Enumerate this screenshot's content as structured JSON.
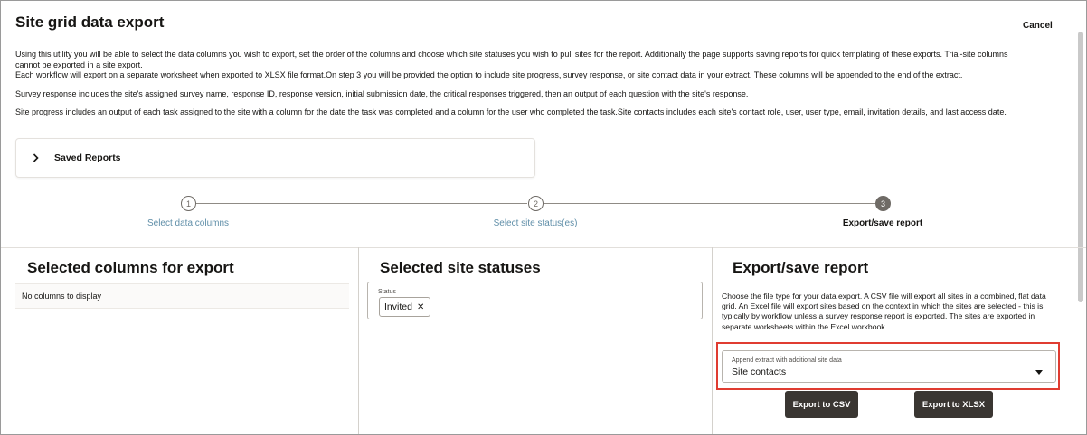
{
  "header": {
    "title": "Site grid data export",
    "cancel_label": "Cancel"
  },
  "intro": {
    "para1_line1": "Using this utility you will be able to select the data columns you wish to export, set the order of the columns and choose which site statuses you wish to pull sites for the report. Additionally the page supports saving reports for quick templating of these exports. Trial-site columns",
    "para1_line2": "cannot be exported in a site export.",
    "para1_line3": "Each workflow will export on a separate worksheet when exported to XLSX file format.On step 3 you will be provided the option to include site progress, survey response, or site contact data in your extract. These columns will be appended to the end of the extract.",
    "para2": "Survey response includes the site's assigned survey name, response ID, response version, initial submission date, the critical responses triggered, then an output of each question with the site's response.",
    "para3": "Site progress includes an output of each task assigned to the site with a column for the date the task was completed and a column for the user who completed the task.Site contacts includes each site's contact role, user, user type, email, invitation details, and last access date."
  },
  "saved_reports": {
    "label": "Saved Reports",
    "icon": "chevron-right-icon"
  },
  "stepper": {
    "steps": [
      {
        "number": "1",
        "label": "Select data columns",
        "state": "complete"
      },
      {
        "number": "2",
        "label": "Select site status(es)",
        "state": "complete"
      },
      {
        "number": "3",
        "label": "Export/save report",
        "state": "active"
      }
    ]
  },
  "columns_panel": {
    "title": "Selected columns for export",
    "empty_text": "No columns to display"
  },
  "status_panel": {
    "title": "Selected site statuses",
    "field_label": "Status",
    "chips": [
      "Invited"
    ]
  },
  "export_panel": {
    "title": "Export/save report",
    "description": "Choose the file type for your data export. A CSV file will export all sites in a combined, flat data grid. An Excel file will export sites based on the context in which the sites are selected - this is typically by workflow unless a survey response report is exported. The sites are exported in separate worksheets within the Excel workbook.",
    "append_label": "Append extract with additional site data",
    "append_value": "Site contacts",
    "csv_button": "Export to CSV",
    "xlsx_button": "Export to XLSX"
  },
  "colors": {
    "primary_button": "#3a3632",
    "link": "#5f8ea8",
    "highlight": "#e03c31"
  }
}
